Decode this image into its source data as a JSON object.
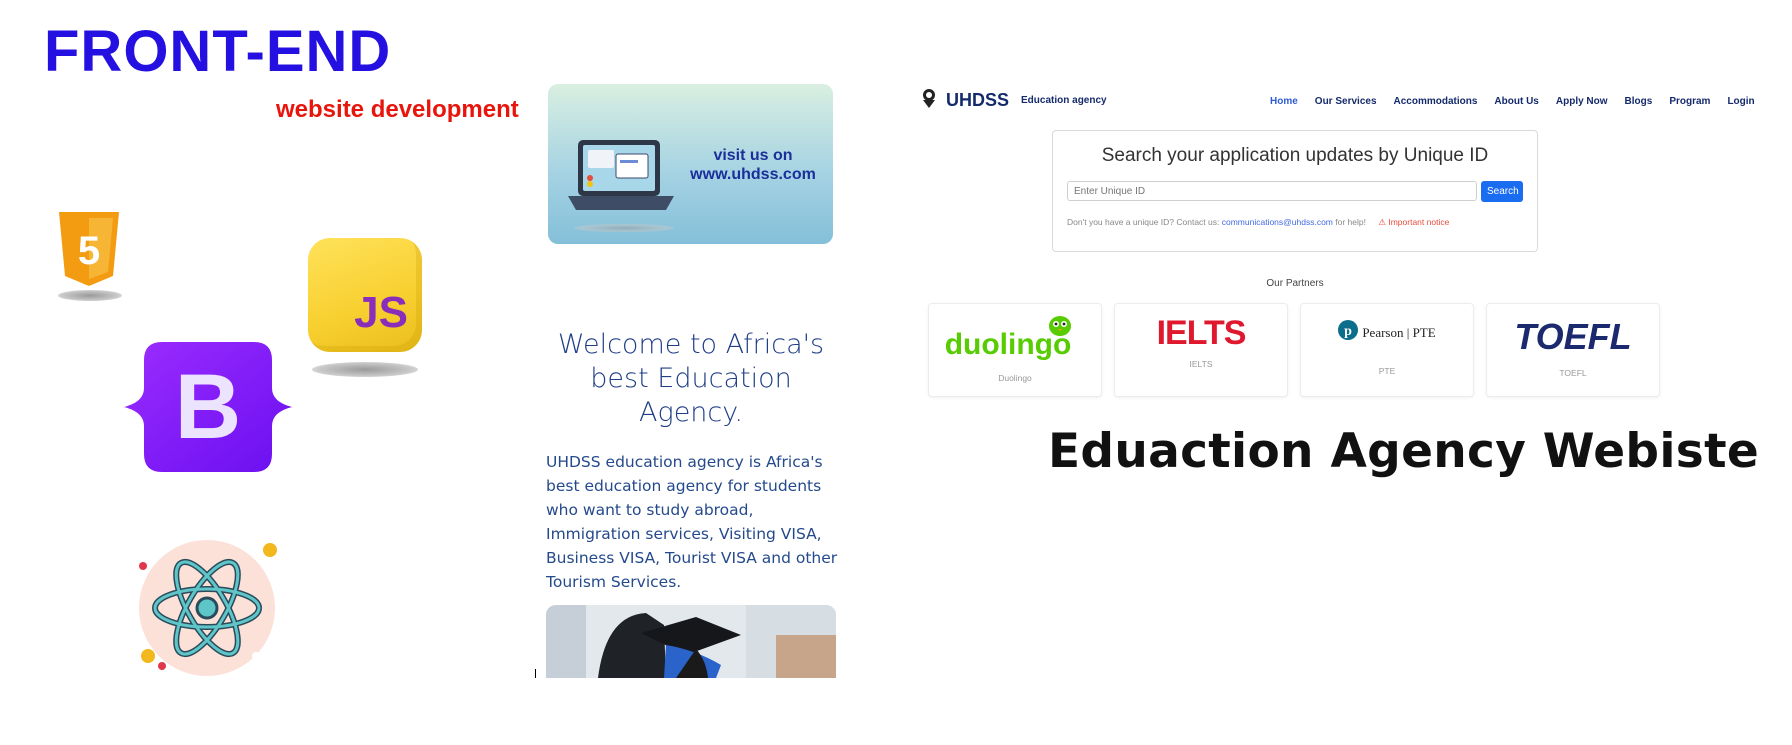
{
  "left_panel": {
    "title": "FRONT-END",
    "subtitle": "website development",
    "icons": [
      "html5-icon",
      "javascript-icon",
      "bootstrap-icon",
      "react-icon"
    ],
    "js_label": "JS",
    "bootstrap_label": "B",
    "html5_label": "5"
  },
  "mobile_mock": {
    "promo_text": "visit us on www.uhdss.com",
    "welcome_heading": "Welcome to Africa's best Education Agency.",
    "welcome_body": "UHDSS education agency is Africa's best education agency for students who want to study abroad, Immigration services, Visiting VISA, Business VISA, Tourist VISA and other Tourism Services."
  },
  "site_mock": {
    "brand": {
      "name": "UHDSS",
      "tagline": "Education agency"
    },
    "nav": [
      {
        "label": "Home",
        "active": true
      },
      {
        "label": "Our Services",
        "active": false
      },
      {
        "label": "Accommodations",
        "active": false
      },
      {
        "label": "About Us",
        "active": false
      },
      {
        "label": "Apply Now",
        "active": false
      },
      {
        "label": "Blogs",
        "active": false
      },
      {
        "label": "Program",
        "active": false
      },
      {
        "label": "Login",
        "active": false
      }
    ],
    "search": {
      "title": "Search your application updates by Unique ID",
      "placeholder": "Enter Unique ID",
      "button": "Search",
      "help_prefix": "Don't you have a unique ID? Contact us:",
      "help_email": "communications@uhdss.com",
      "help_suffix": "for help!",
      "notice": "Important notice"
    },
    "partners_title": "Our Partners",
    "partners": [
      {
        "logo": "duolingo",
        "name": "Duolingo"
      },
      {
        "logo": "IELTS",
        "name": "IELTS"
      },
      {
        "logo": "Pearson | PTE",
        "name": "PTE"
      },
      {
        "logo": "TOEFL",
        "name": "TOEFL"
      }
    ]
  },
  "heading": "Eduaction Agency Webiste",
  "colors": {
    "title_blue": "#2410e0",
    "subtitle_red": "#e8150c",
    "js_yellow": "#f7d138",
    "bootstrap_purple": "#7a12f5",
    "html_orange": "#f39c12",
    "navy": "#142a6b",
    "search_button": "#1a6cf0",
    "duolingo_green": "#58cc02",
    "ielts_red": "#e0182d",
    "toefl_navy": "#1b2a6e"
  }
}
